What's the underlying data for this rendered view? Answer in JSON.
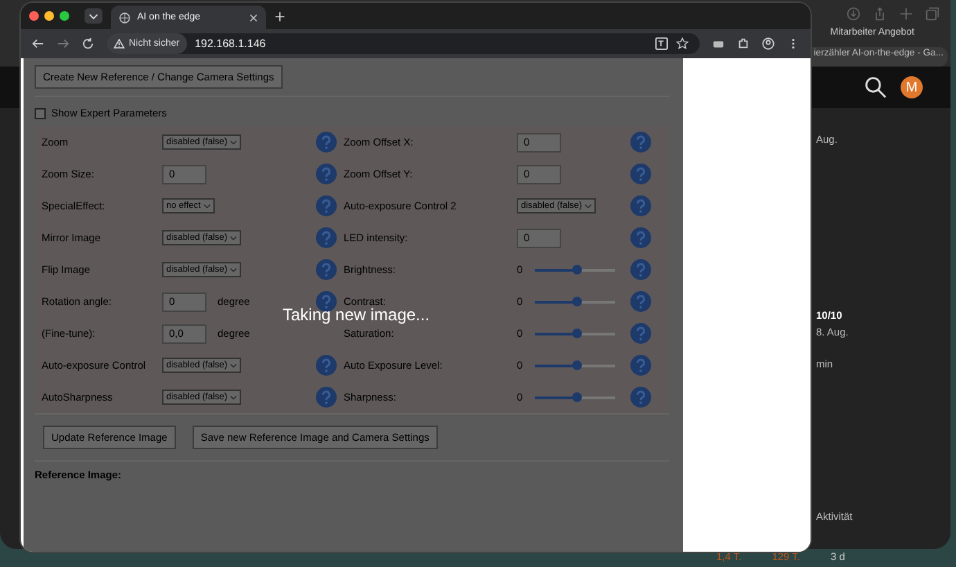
{
  "back_window": {
    "bookmark": "Mitarbeiter Angebot",
    "address": "ierzähler AI-on-the-edge - Ga...",
    "avatar": "M",
    "texts": [
      "Aug.",
      "10/10",
      "8. Aug.",
      "min",
      "Aktivität"
    ],
    "stats": [
      {
        "text": "1,4 T.",
        "color": "#c0561e"
      },
      {
        "text": "129 T.",
        "color": "#c0561e"
      },
      {
        "text": "3 d",
        "color": "#cccccc"
      }
    ]
  },
  "browser": {
    "tab_title": "AI on the edge",
    "security": "Nicht sicher",
    "address": "192.168.1.146"
  },
  "page": {
    "top_button": "Create New Reference / Change Camera Settings",
    "expert": {
      "label": "Show Expert Parameters",
      "checked": false
    },
    "rows": [
      [
        {
          "label": "Zoom",
          "kind": "select",
          "value": "disabled (false)",
          "help": true
        },
        {
          "label": "Zoom Offset X:",
          "kind": "number",
          "value": "0",
          "help": true
        }
      ],
      [
        {
          "label": "Zoom Size:",
          "kind": "number",
          "value": "0",
          "help": true
        },
        {
          "label": "Zoom Offset Y:",
          "kind": "number",
          "value": "0",
          "help": true
        }
      ],
      [
        {
          "label": "SpecialEffect:",
          "kind": "select",
          "value": "no effect",
          "help": true
        },
        {
          "label": "Auto-exposure Control 2",
          "kind": "select",
          "value": "disabled (false)",
          "help": true
        }
      ],
      [
        {
          "label": "Mirror Image",
          "kind": "select",
          "value": "disabled (false)",
          "help": true
        },
        {
          "label": "LED intensity:",
          "kind": "number",
          "value": "0",
          "help": true
        }
      ],
      [
        {
          "label": "Flip Image",
          "kind": "select",
          "value": "disabled (false)",
          "help": true
        },
        {
          "label": "Brightness:",
          "kind": "slider",
          "value": "0",
          "level": 0.52,
          "help": true
        }
      ],
      [
        {
          "label": "Rotation angle:",
          "kind": "number",
          "value": "0",
          "unit": "degree",
          "help": true
        },
        {
          "label": "Contrast:",
          "kind": "slider",
          "value": "0",
          "level": 0.52,
          "help": true
        }
      ],
      [
        {
          "label": "(Fine-tune):",
          "kind": "number",
          "value": "0,0",
          "unit": "degree",
          "help": false
        },
        {
          "label": "Saturation:",
          "kind": "slider",
          "value": "0",
          "level": 0.52,
          "help": true
        }
      ],
      [
        {
          "label": "Auto-exposure Control",
          "kind": "select",
          "value": "disabled (false)",
          "help": true
        },
        {
          "label": "Auto Exposure Level:",
          "kind": "slider",
          "value": "0",
          "level": 0.52,
          "help": true
        }
      ],
      [
        {
          "label": "AutoSharpness",
          "kind": "select",
          "value": "disabled (false)",
          "help": true
        },
        {
          "label": "Sharpness:",
          "kind": "slider",
          "value": "0",
          "level": 0.52,
          "help": true
        }
      ]
    ],
    "buttons": [
      "Update Reference Image",
      "Save new Reference Image and Camera Settings"
    ],
    "reference_label": "Reference Image:",
    "overlay": "Taking new image..."
  }
}
